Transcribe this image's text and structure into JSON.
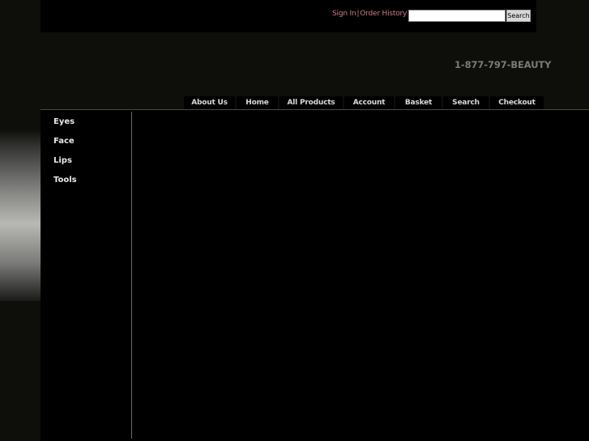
{
  "header": {
    "sign_in_label": "Sign In",
    "separator": "|",
    "order_history_label": "Order History",
    "search_input_value": "",
    "search_button_label": "Search",
    "phone": "1-877-797-BEAUTY"
  },
  "nav": {
    "items": [
      {
        "label": "About Us"
      },
      {
        "label": "Home"
      },
      {
        "label": "All Products"
      },
      {
        "label": "Account"
      },
      {
        "label": "Basket"
      },
      {
        "label": "Search"
      },
      {
        "label": "Checkout"
      }
    ]
  },
  "sidebar": {
    "items": [
      {
        "label": "Eyes"
      },
      {
        "label": "Face"
      },
      {
        "label": "Lips"
      },
      {
        "label": "Tools"
      }
    ]
  },
  "colors": {
    "page_background": "#0e0e0a",
    "panel_background": "#000000",
    "link_color": "#d07a8a",
    "phone_color": "#7a7a7a",
    "nav_text": "#d8d8d8"
  }
}
